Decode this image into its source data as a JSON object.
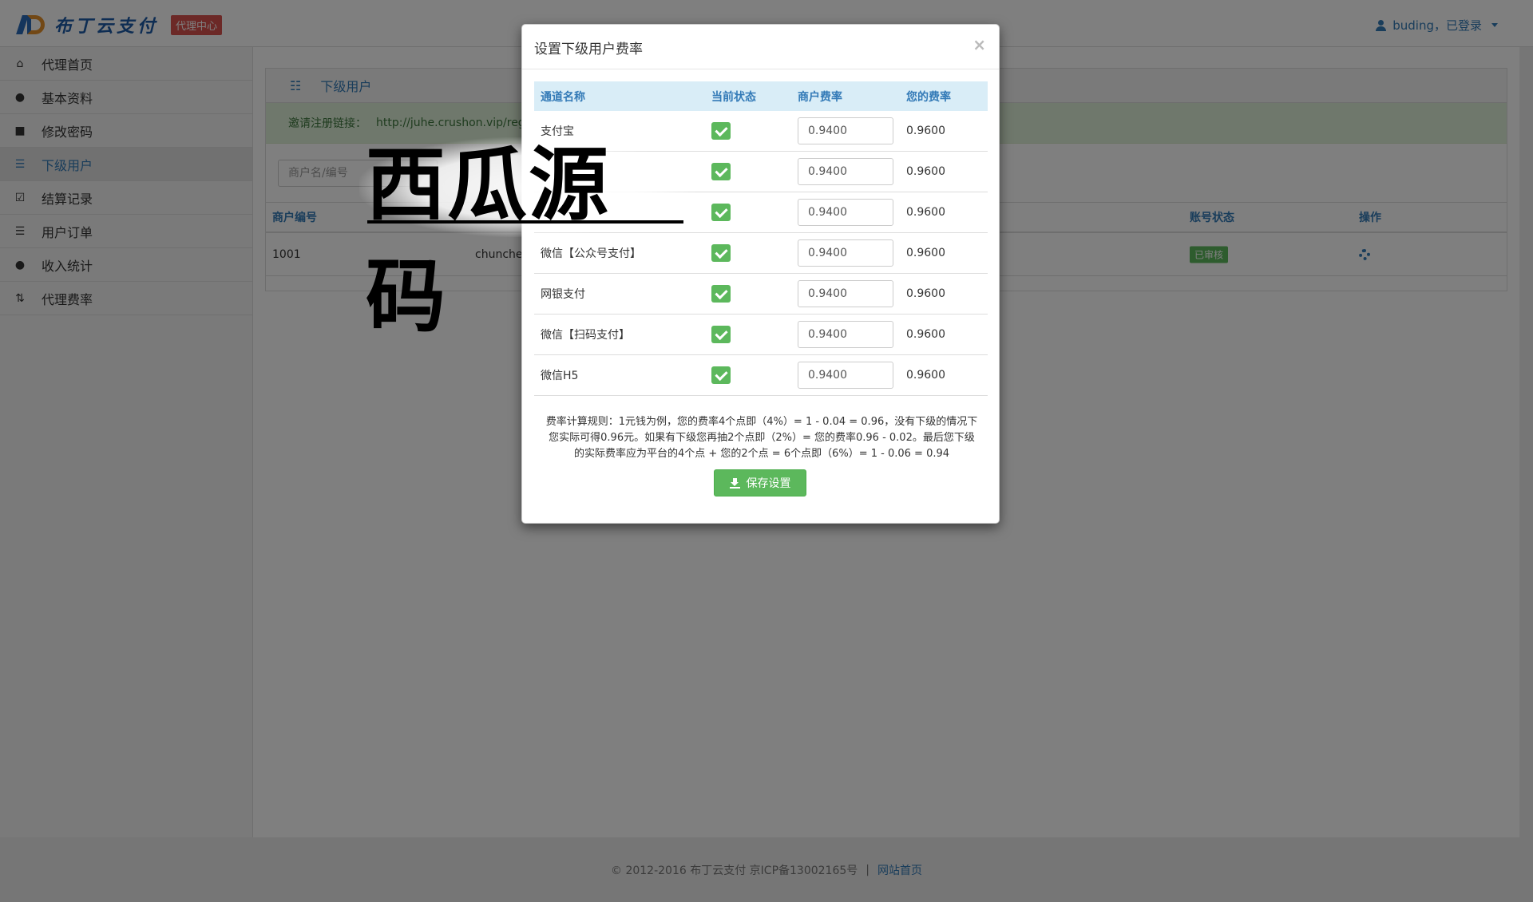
{
  "header": {
    "logo_text": "布丁云支付",
    "center_badge": "代理中心",
    "user_label": "buding，已登录"
  },
  "sidebar": {
    "items": [
      {
        "label": "代理首页",
        "icon": "home-icon"
      },
      {
        "label": "基本资料",
        "icon": "user-icon"
      },
      {
        "label": "修改密码",
        "icon": "lock-icon"
      },
      {
        "label": "下级用户",
        "icon": "list-icon",
        "active": true
      },
      {
        "label": "结算记录",
        "icon": "check-square-icon"
      },
      {
        "label": "用户订单",
        "icon": "list-icon"
      },
      {
        "label": "收入统计",
        "icon": "piggy-bank-icon"
      },
      {
        "label": "代理费率",
        "icon": "sort-icon"
      }
    ]
  },
  "panel": {
    "title": "下级用户",
    "invite_label": "邀请注册链接：",
    "invite_url": "http://juhe.crushon.vip/regis",
    "search_placeholder": "商户名/编号",
    "columns": {
      "merchant_id": "商户编号",
      "account_status": "账号状态",
      "action": "操作"
    },
    "rows": [
      {
        "merchant_id": "1001",
        "name": "chunche",
        "status": "已审核"
      }
    ]
  },
  "modal": {
    "title": "设置下级用户费率",
    "columns": {
      "channel": "通道名称",
      "state": "当前状态",
      "merchant_rate": "商户费率",
      "your_rate": "您的费率"
    },
    "rows": [
      {
        "channel": "支付宝",
        "checked": true,
        "merchant_rate": "0.9400",
        "your_rate": "0.9600"
      },
      {
        "channel": "",
        "checked": true,
        "merchant_rate": "0.9400",
        "your_rate": "0.9600"
      },
      {
        "channel": "",
        "checked": true,
        "merchant_rate": "0.9400",
        "your_rate": "0.9600"
      },
      {
        "channel": "微信【公众号支付】",
        "checked": true,
        "merchant_rate": "0.9400",
        "your_rate": "0.9600"
      },
      {
        "channel": "网银支付",
        "checked": true,
        "merchant_rate": "0.9400",
        "your_rate": "0.9600"
      },
      {
        "channel": "微信【扫码支付】",
        "checked": true,
        "merchant_rate": "0.9400",
        "your_rate": "0.9600"
      },
      {
        "channel": "微信H5",
        "checked": true,
        "merchant_rate": "0.9400",
        "your_rate": "0.9600"
      }
    ],
    "rule_line1": "费率计算规则：1元钱为例，您的费率4个点即（4%）= 1 - 0.04 = 0.96，没有下级的情况下",
    "rule_line2": "您实际可得0.96元。如果有下级您再抽2个点即（2%）= 您的费率0.96 - 0.02。最后您下级",
    "rule_line3": "的实际费率应为平台的4个点 + 您的2个点 = 6个点即（6%）= 1 - 0.06 = 0.94",
    "save_label": "保存设置",
    "close_symbol": "×"
  },
  "watermark": {
    "text": "西瓜源码"
  },
  "footer": {
    "copyright": "© 2012-2016  布丁云支付  京ICP备13002165号",
    "separator": "|",
    "home_link": "网站首页"
  },
  "colors": {
    "primary": "#337ab7",
    "success": "#5cb85c",
    "danger": "#d9534f",
    "backdrop": "rgba(0,0,0,0.5)"
  }
}
